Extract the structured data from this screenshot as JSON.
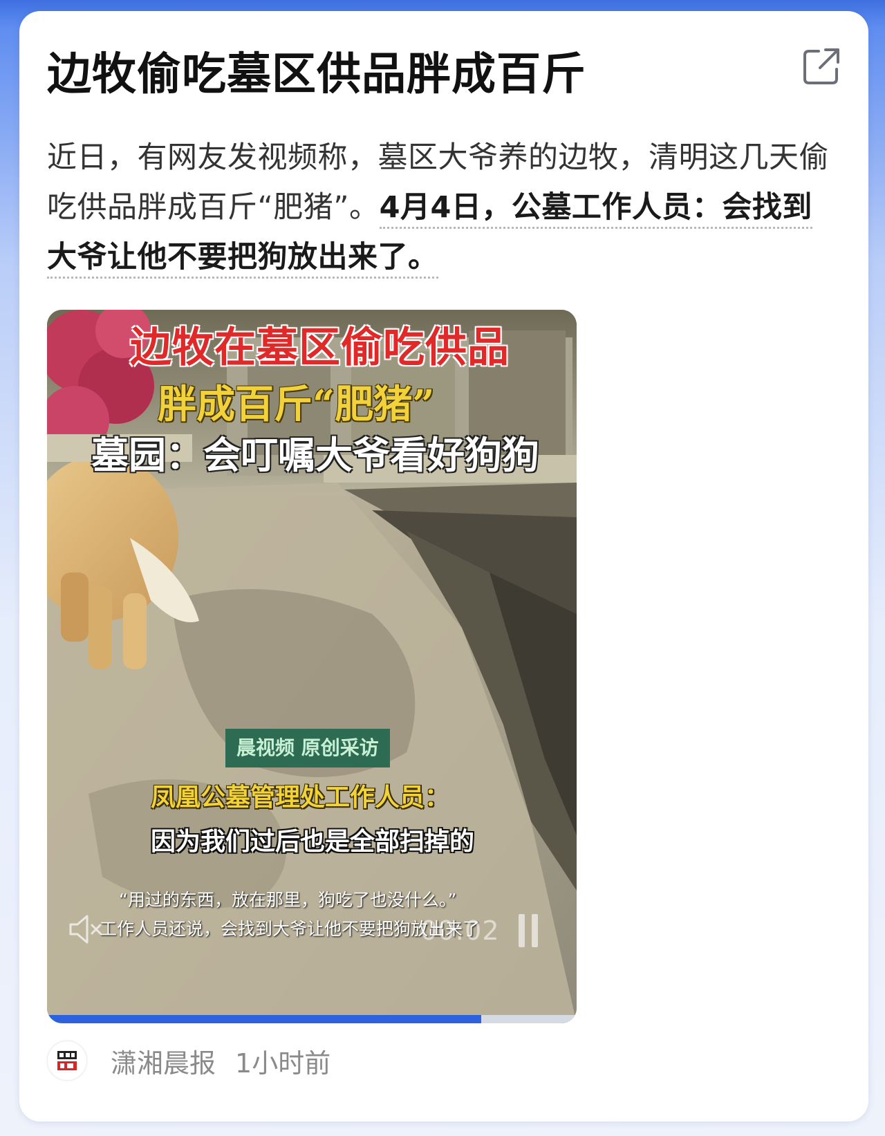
{
  "article": {
    "title": "边牧偷吃墓区供品胖成百斤",
    "summary_plain": "近日，有网友发视频称，墓区大爷养的边牧，清明这几天偷吃供品胖成百斤“肥猪”。",
    "summary_highlight": "4月4日，公墓工作人员：会找到大爷让他不要把狗放出来了。"
  },
  "video": {
    "caption_line1": "边牧在墓区偷吃供品",
    "caption_line2": "胖成百斤“肥猪”",
    "caption_line3": "墓园：会叮嘱大爷看好狗狗",
    "badge": "晨视频 原创采访",
    "speaker_label": "凤凰公墓管理处工作人员：",
    "speaker_quote": "因为我们过后也是全部扫掉的",
    "subtitle_1": "“用过的东西，放在那里，狗吃了也没什么。”",
    "subtitle_2": "工作人员还说，会找到大爷让他不要把狗放出来了",
    "time": "00:02",
    "progress": 0.82
  },
  "footer": {
    "source": "潇湘晨报",
    "time_ago": "1小时前"
  },
  "colors": {
    "accent": "#2c62e0",
    "title": "#111111",
    "meta": "#8a8a8a"
  },
  "icons": {
    "share": "share-external-icon",
    "mute": "speaker-muted-icon",
    "pause": "pause-icon"
  }
}
